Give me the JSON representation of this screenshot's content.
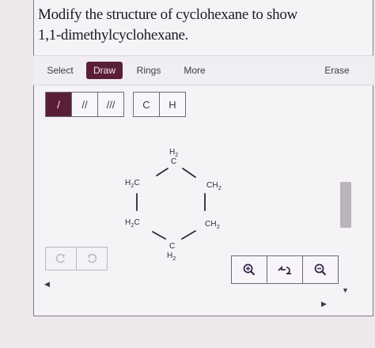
{
  "question": {
    "line1": "Modify the structure of cyclohexane to show",
    "line2": "1,1-dimethylcyclohexane."
  },
  "toolbar": {
    "select": "Select",
    "draw": "Draw",
    "rings": "Rings",
    "more": "More",
    "erase": "Erase"
  },
  "bonds": {
    "single": "/",
    "double": "//",
    "triple": "///",
    "carbon": "C",
    "hydrogen": "H"
  },
  "molecule": {
    "top_h2": "H",
    "top_h2_sub": "2",
    "top_c": "C",
    "left_top": "H",
    "left_top_sub": "2",
    "left_top_c": "C",
    "right_top": "CH",
    "right_top_sub": "2",
    "left_bottom": "H",
    "left_bottom_sub": "2",
    "left_bottom_c": "C",
    "right_bottom": "CH",
    "right_bottom_sub": "2",
    "bottom_c": "C",
    "bottom_h2": "H",
    "bottom_h2_sub": "2"
  },
  "icons": {
    "undo": "undo-icon",
    "redo": "redo-icon",
    "zoom_in": "zoom-in-icon",
    "reset": "reset-view-icon",
    "zoom_out": "zoom-out-icon"
  }
}
